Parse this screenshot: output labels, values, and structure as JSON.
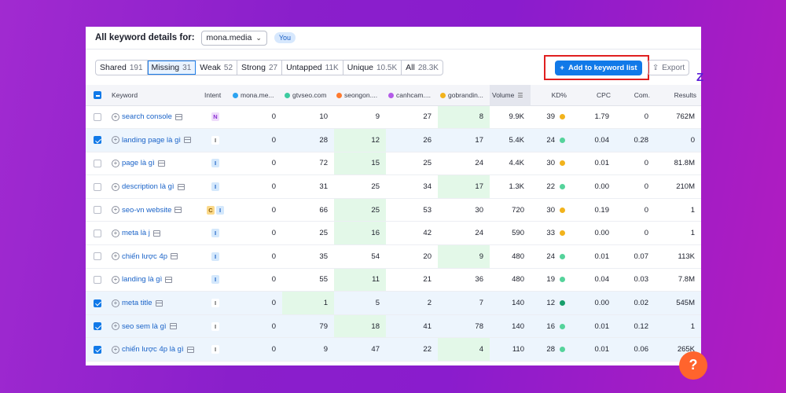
{
  "header": {
    "title": "All keyword details for:",
    "domain": "mona.media",
    "you_badge": "You"
  },
  "filters": [
    {
      "label": "Shared",
      "count": "191",
      "active": false
    },
    {
      "label": "Missing",
      "count": "31",
      "active": true
    },
    {
      "label": "Weak",
      "count": "52",
      "active": false
    },
    {
      "label": "Strong",
      "count": "27",
      "active": false
    },
    {
      "label": "Untapped",
      "count": "11K",
      "active": false
    },
    {
      "label": "Unique",
      "count": "10.5K",
      "active": false
    },
    {
      "label": "All",
      "count": "28.3K",
      "active": false
    }
  ],
  "toolbar": {
    "add_label": "Add to keyword list",
    "export_label": "Export"
  },
  "columns": {
    "keyword": "Keyword",
    "intent": "Intent",
    "d1": "mona.me...",
    "d2": "gtvseo.com",
    "d3": "seongon....",
    "d4": "canhcam....",
    "d5": "gobrandin...",
    "volume": "Volume",
    "kd": "KD%",
    "cpc": "CPC",
    "com": "Com.",
    "results": "Results"
  },
  "domain_colors": [
    "#2ca3f0",
    "#3ccba0",
    "#ff7a2e",
    "#b45be8",
    "#f2b31c"
  ],
  "rows": [
    {
      "selected": false,
      "keyword": "search console",
      "intents": [
        "N"
      ],
      "d": [
        "0",
        "10",
        "9",
        "27",
        "8"
      ],
      "best": 4,
      "volume": "9.9K",
      "kd": "39",
      "kd_color": "#f2b31c",
      "cpc": "1.79",
      "com": "0",
      "results": "762M"
    },
    {
      "selected": true,
      "keyword": "landing page là gì",
      "intents": [
        "I2"
      ],
      "d": [
        "0",
        "28",
        "12",
        "26",
        "17"
      ],
      "best": 2,
      "volume": "5.4K",
      "kd": "24",
      "kd_color": "#55d39b",
      "cpc": "0.04",
      "com": "0.28",
      "results": "0"
    },
    {
      "selected": false,
      "keyword": "page là gì",
      "intents": [
        "I"
      ],
      "d": [
        "0",
        "72",
        "15",
        "25",
        "24"
      ],
      "best": 2,
      "volume": "4.4K",
      "kd": "30",
      "kd_color": "#f2b31c",
      "cpc": "0.01",
      "com": "0",
      "results": "81.8M"
    },
    {
      "selected": false,
      "keyword": "description là gì",
      "intents": [
        "I"
      ],
      "d": [
        "0",
        "31",
        "25",
        "34",
        "17"
      ],
      "best": 4,
      "volume": "1.3K",
      "kd": "22",
      "kd_color": "#55d39b",
      "cpc": "0.00",
      "com": "0",
      "results": "210M"
    },
    {
      "selected": false,
      "keyword": "seo-vn website",
      "intents": [
        "C",
        "I"
      ],
      "d": [
        "0",
        "66",
        "25",
        "53",
        "30"
      ],
      "best": 2,
      "volume": "720",
      "kd": "30",
      "kd_color": "#f2b31c",
      "cpc": "0.19",
      "com": "0",
      "results": "1"
    },
    {
      "selected": false,
      "keyword": "meta là j",
      "intents": [
        "I"
      ],
      "d": [
        "0",
        "25",
        "16",
        "42",
        "24"
      ],
      "best": 2,
      "volume": "590",
      "kd": "33",
      "kd_color": "#f2b31c",
      "cpc": "0.00",
      "com": "0",
      "results": "1"
    },
    {
      "selected": false,
      "keyword": "chiến lược 4p",
      "intents": [
        "I"
      ],
      "d": [
        "0",
        "35",
        "54",
        "20",
        "9"
      ],
      "best": 4,
      "volume": "480",
      "kd": "24",
      "kd_color": "#55d39b",
      "cpc": "0.01",
      "com": "0.07",
      "results": "113K"
    },
    {
      "selected": false,
      "keyword": "landing là gì",
      "intents": [
        "I"
      ],
      "d": [
        "0",
        "55",
        "11",
        "21",
        "36"
      ],
      "best": 2,
      "volume": "480",
      "kd": "19",
      "kd_color": "#55d39b",
      "cpc": "0.04",
      "com": "0.03",
      "results": "7.8M"
    },
    {
      "selected": true,
      "keyword": "meta title",
      "intents": [
        "I2"
      ],
      "d": [
        "0",
        "1",
        "5",
        "2",
        "7"
      ],
      "best": 1,
      "volume": "140",
      "kd": "12",
      "kd_color": "#169e6b",
      "cpc": "0.00",
      "com": "0.02",
      "results": "545M"
    },
    {
      "selected": true,
      "keyword": "seo sem là gì",
      "intents": [
        "I2"
      ],
      "d": [
        "0",
        "79",
        "18",
        "41",
        "78"
      ],
      "best": 2,
      "volume": "140",
      "kd": "16",
      "kd_color": "#55d39b",
      "cpc": "0.01",
      "com": "0.12",
      "results": "1"
    },
    {
      "selected": true,
      "keyword": "chiến lược 4p là gì",
      "intents": [
        "I2"
      ],
      "d": [
        "0",
        "9",
        "47",
        "22",
        "4"
      ],
      "best": 4,
      "volume": "110",
      "kd": "28",
      "kd_color": "#55d39b",
      "cpc": "0.01",
      "com": "0.06",
      "results": "265K"
    }
  ],
  "help": {
    "label": "?"
  }
}
